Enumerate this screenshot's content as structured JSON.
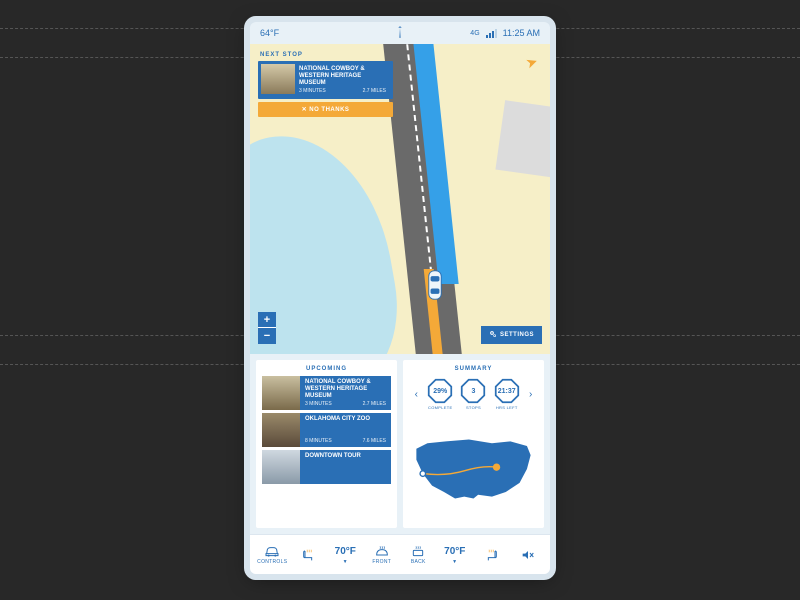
{
  "status": {
    "temperature": "64°F",
    "network": "4G",
    "time": "11:25 AM"
  },
  "next_stop": {
    "label": "NEXT STOP",
    "title": "NATIONAL COWBOY & WESTERN HERITAGE MUSEUM",
    "time": "3 MINUTES",
    "distance": "2.7 MILES",
    "dismiss_label": "NO THANKS"
  },
  "map": {
    "zoom_in": "+",
    "zoom_out": "−",
    "settings_label": "SETTINGS"
  },
  "upcoming": {
    "title": "UPCOMING",
    "items": [
      {
        "title": "NATIONAL COWBOY & WESTERN HERITAGE MUSEUM",
        "time": "3 MINUTES",
        "distance": "2.7 MILES"
      },
      {
        "title": "OKLAHOMA CITY ZOO",
        "time": "8 MINUTES",
        "distance": "7.6 MILES"
      },
      {
        "title": "DOWNTOWN TOUR",
        "time": "",
        "distance": ""
      }
    ]
  },
  "summary": {
    "title": "SUMMARY",
    "stats": [
      {
        "value": "29%",
        "label": "COMPLETE"
      },
      {
        "value": "3",
        "label": "STOPS"
      },
      {
        "value": "21:37",
        "label": "HRS LEFT"
      }
    ]
  },
  "controls": {
    "items": [
      {
        "label": "CONTROLS",
        "icon": "car-icon"
      },
      {
        "label": "",
        "icon": "seat-heat-left-icon"
      },
      {
        "label": "70°F",
        "icon": "temp-left-icon"
      },
      {
        "label": "FRONT",
        "icon": "defrost-front-icon"
      },
      {
        "label": "BACK",
        "icon": "defrost-rear-icon"
      },
      {
        "label": "70°F",
        "icon": "temp-right-icon"
      },
      {
        "label": "",
        "icon": "seat-heat-right-icon"
      },
      {
        "label": "",
        "icon": "volume-mute-icon"
      }
    ]
  },
  "colors": {
    "primary": "#2a6fb5",
    "accent": "#f4a938",
    "route": "#35a0e8"
  }
}
